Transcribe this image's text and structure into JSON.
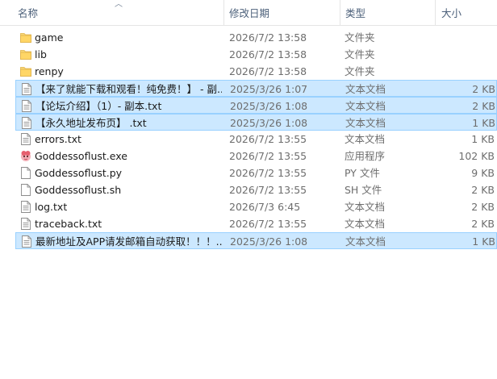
{
  "columns": {
    "name": "名称",
    "date": "修改日期",
    "type": "类型",
    "size": "大小"
  },
  "files": [
    {
      "name": "game",
      "date": "2026/7/2 13:58",
      "type": "文件夹",
      "size": "",
      "icon": "folder-icon",
      "selected": false
    },
    {
      "name": "lib",
      "date": "2026/7/2 13:58",
      "type": "文件夹",
      "size": "",
      "icon": "folder-icon",
      "selected": false
    },
    {
      "name": "renpy",
      "date": "2026/7/2 13:58",
      "type": "文件夹",
      "size": "",
      "icon": "folder-icon",
      "selected": false
    },
    {
      "name": "【来了就能下载和观看！纯免费！】 - 副...",
      "date": "2025/3/26 1:07",
      "type": "文本文档",
      "size": "2 KB",
      "icon": "text-file-icon",
      "selected": true
    },
    {
      "name": "【论坛介绍】（1）- 副本.txt",
      "date": "2025/3/26 1:08",
      "type": "文本文档",
      "size": "2 KB",
      "icon": "text-file-icon",
      "selected": true
    },
    {
      "name": "【永久地址发布页】 .txt",
      "date": "2025/3/26 1:08",
      "type": "文本文档",
      "size": "1 KB",
      "icon": "text-file-icon",
      "selected": true
    },
    {
      "name": "errors.txt",
      "date": "2026/7/2 13:55",
      "type": "文本文档",
      "size": "1 KB",
      "icon": "text-file-icon",
      "selected": false
    },
    {
      "name": "Goddessoflust.exe",
      "date": "2026/7/2 13:55",
      "type": "应用程序",
      "size": "102 KB",
      "icon": "app-exe-icon",
      "selected": false
    },
    {
      "name": "Goddessoflust.py",
      "date": "2026/7/2 13:55",
      "type": "PY 文件",
      "size": "9 KB",
      "icon": "blank-file-icon",
      "selected": false
    },
    {
      "name": "Goddessoflust.sh",
      "date": "2026/7/2 13:55",
      "type": "SH 文件",
      "size": "2 KB",
      "icon": "blank-file-icon",
      "selected": false
    },
    {
      "name": "log.txt",
      "date": "2026/7/3 6:45",
      "type": "文本文档",
      "size": "2 KB",
      "icon": "text-file-icon",
      "selected": false
    },
    {
      "name": "traceback.txt",
      "date": "2026/7/2 13:55",
      "type": "文本文档",
      "size": "2 KB",
      "icon": "text-file-icon",
      "selected": false
    },
    {
      "name": "最新地址及APP请发邮箱自动获取！！！...",
      "date": "2025/3/26 1:08",
      "type": "文本文档",
      "size": "1 KB",
      "icon": "text-file-icon",
      "selected": true
    }
  ]
}
